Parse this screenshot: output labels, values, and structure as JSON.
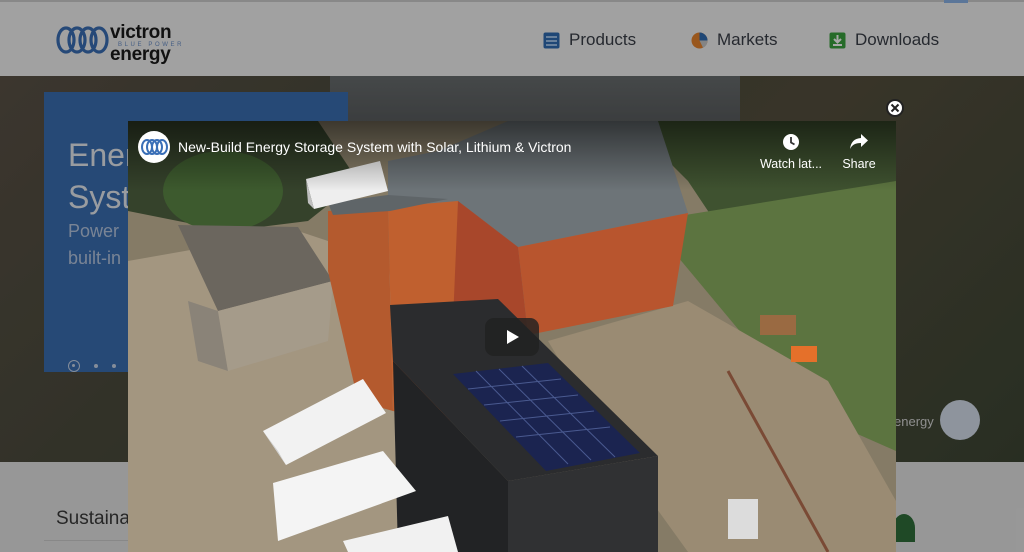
{
  "brand": {
    "name": "victron energy",
    "tagline": "BLUE POWER",
    "blue": "#3a6fb7"
  },
  "nav": {
    "items": [
      {
        "label": "Products",
        "icon": "products-icon"
      },
      {
        "label": "Markets",
        "icon": "markets-pie-icon"
      },
      {
        "label": "Downloads",
        "icon": "downloads-icon"
      }
    ]
  },
  "hero": {
    "title": "Energy\nSystems",
    "subtitle": "Power\nbuilt-in",
    "right_caption": "energy"
  },
  "section": {
    "title": "Sustaina"
  },
  "modal": {
    "close_icon": "close-circle-icon"
  },
  "video": {
    "title": "New-Build Energy Storage System with Solar, Lithium & Victron",
    "watch_later_label": "Watch lat...",
    "share_label": "Share",
    "play_icon": "play-icon"
  }
}
